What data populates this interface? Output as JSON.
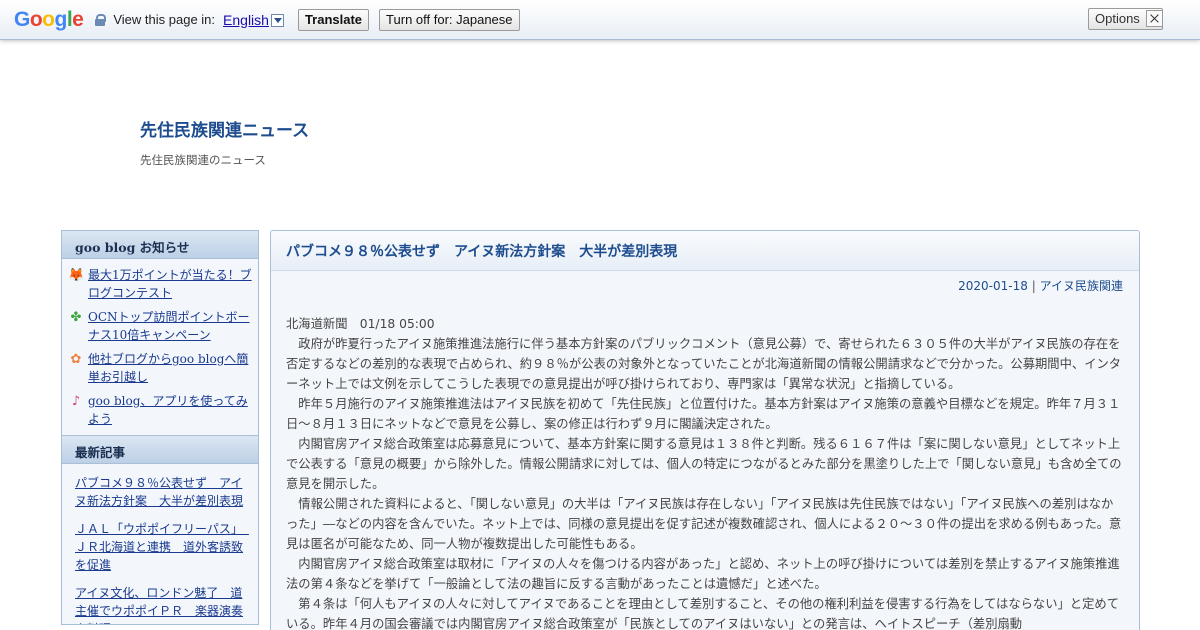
{
  "translate_bar": {
    "logo": [
      "G",
      "o",
      "o",
      "g",
      "l",
      "e"
    ],
    "view_text": "View this page in:",
    "language": "English",
    "translate_label": "Translate",
    "turn_off_label": "Turn off for: Japanese",
    "options_label": "Options ▼"
  },
  "blog": {
    "title": "先住民族関連ニュース",
    "description": "先住民族関連のニュース"
  },
  "sidebar": {
    "notice_heading": "goo blog お知らせ",
    "notices": [
      {
        "icon": "fox-icon",
        "glyph": "🦊",
        "label": "最大1万ポイントが当たる！ブログコンテスト"
      },
      {
        "icon": "clover-icon",
        "glyph": "✤",
        "label": "OCNトップ訪問ポイントボーナス10倍キャンペーン"
      },
      {
        "icon": "flower-icon",
        "glyph": "✿",
        "label": "他社ブログからgoo blogへ簡単お引越し"
      },
      {
        "icon": "music-note-icon",
        "glyph": "♪",
        "label": "goo blog、アプリを使ってみよう"
      }
    ],
    "recent_heading": "最新記事",
    "recent": [
      "パブコメ９８％公表せず　アイヌ新法方針案　大半が差別表現",
      "ＪＡＬ「ウポポイフリーパス」　ＪＲ北海道と連携　道外客誘致を促進",
      "アイヌ文化、ロンドン魅了　道主催でウポポイＰＲ　楽器演奏や料理"
    ]
  },
  "article": {
    "title": "パブコメ９８％公表せず　アイヌ新法方針案　大半が差別表現",
    "date": "2020-01-18",
    "separator": "|",
    "category": "アイヌ民族関連",
    "source": "北海道新聞　01/18 05:00",
    "paragraphs": [
      "政府が昨夏行ったアイヌ施策推進法施行に伴う基本方針案のパブリックコメント（意見公募）で、寄せられた６３０５件の大半がアイヌ民族の存在を否定するなどの差別的な表現で占められ、約９８％が公表の対象外となっていたことが北海道新聞の情報公開請求などで分かった。公募期間中、インターネット上では文例を示してこうした表現での意見提出が呼び掛けられており、専門家は「異常な状況」と指摘している。",
      "昨年５月施行のアイヌ施策推進法はアイヌ民族を初めて「先住民族」と位置付けた。基本方針案はアイヌ施策の意義や目標などを規定。昨年７月３１日～８月１３日にネットなどで意見を公募し、案の修正は行わず９月に閣議決定された。",
      "内閣官房アイヌ総合政策室は応募意見について、基本方針案に関する意見は１３８件と判断。残る６１６７件は「案に関しない意見」としてネット上で公表する「意見の概要」から除外した。情報公開請求に対しては、個人の特定につながるとみた部分を黒塗りした上で「関しない意見」も含め全ての意見を開示した。",
      "情報公開された資料によると、「関しない意見」の大半は「アイヌ民族は存在しない」「アイヌ民族は先住民族ではない」「アイヌ民族への差別はなかった」―などの内容を含んでいた。ネット上では、同様の意見提出を促す記述が複数確認され、個人による２０～３０件の提出を求める例もあった。意見は匿名が可能なため、同一人物が複数提出した可能性もある。",
      "内閣官房アイヌ総合政策室は取材に「アイヌの人々を傷つける内容があった」と認め、ネット上の呼び掛けについては差別を禁止するアイヌ施策推進法の第４条などを挙げて「一般論として法の趣旨に反する言動があったことは遺憾だ」と述べた。",
      "第４条は「何人もアイヌの人々に対してアイヌであることを理由として差別すること、その他の権利利益を侵害する行為をしてはならない」と定めている。昨年４月の国会審議では内閣官房アイヌ総合政策室が「民族としてのアイヌはいない」との発言は、ヘイトスピーチ（差別扇動"
    ]
  }
}
